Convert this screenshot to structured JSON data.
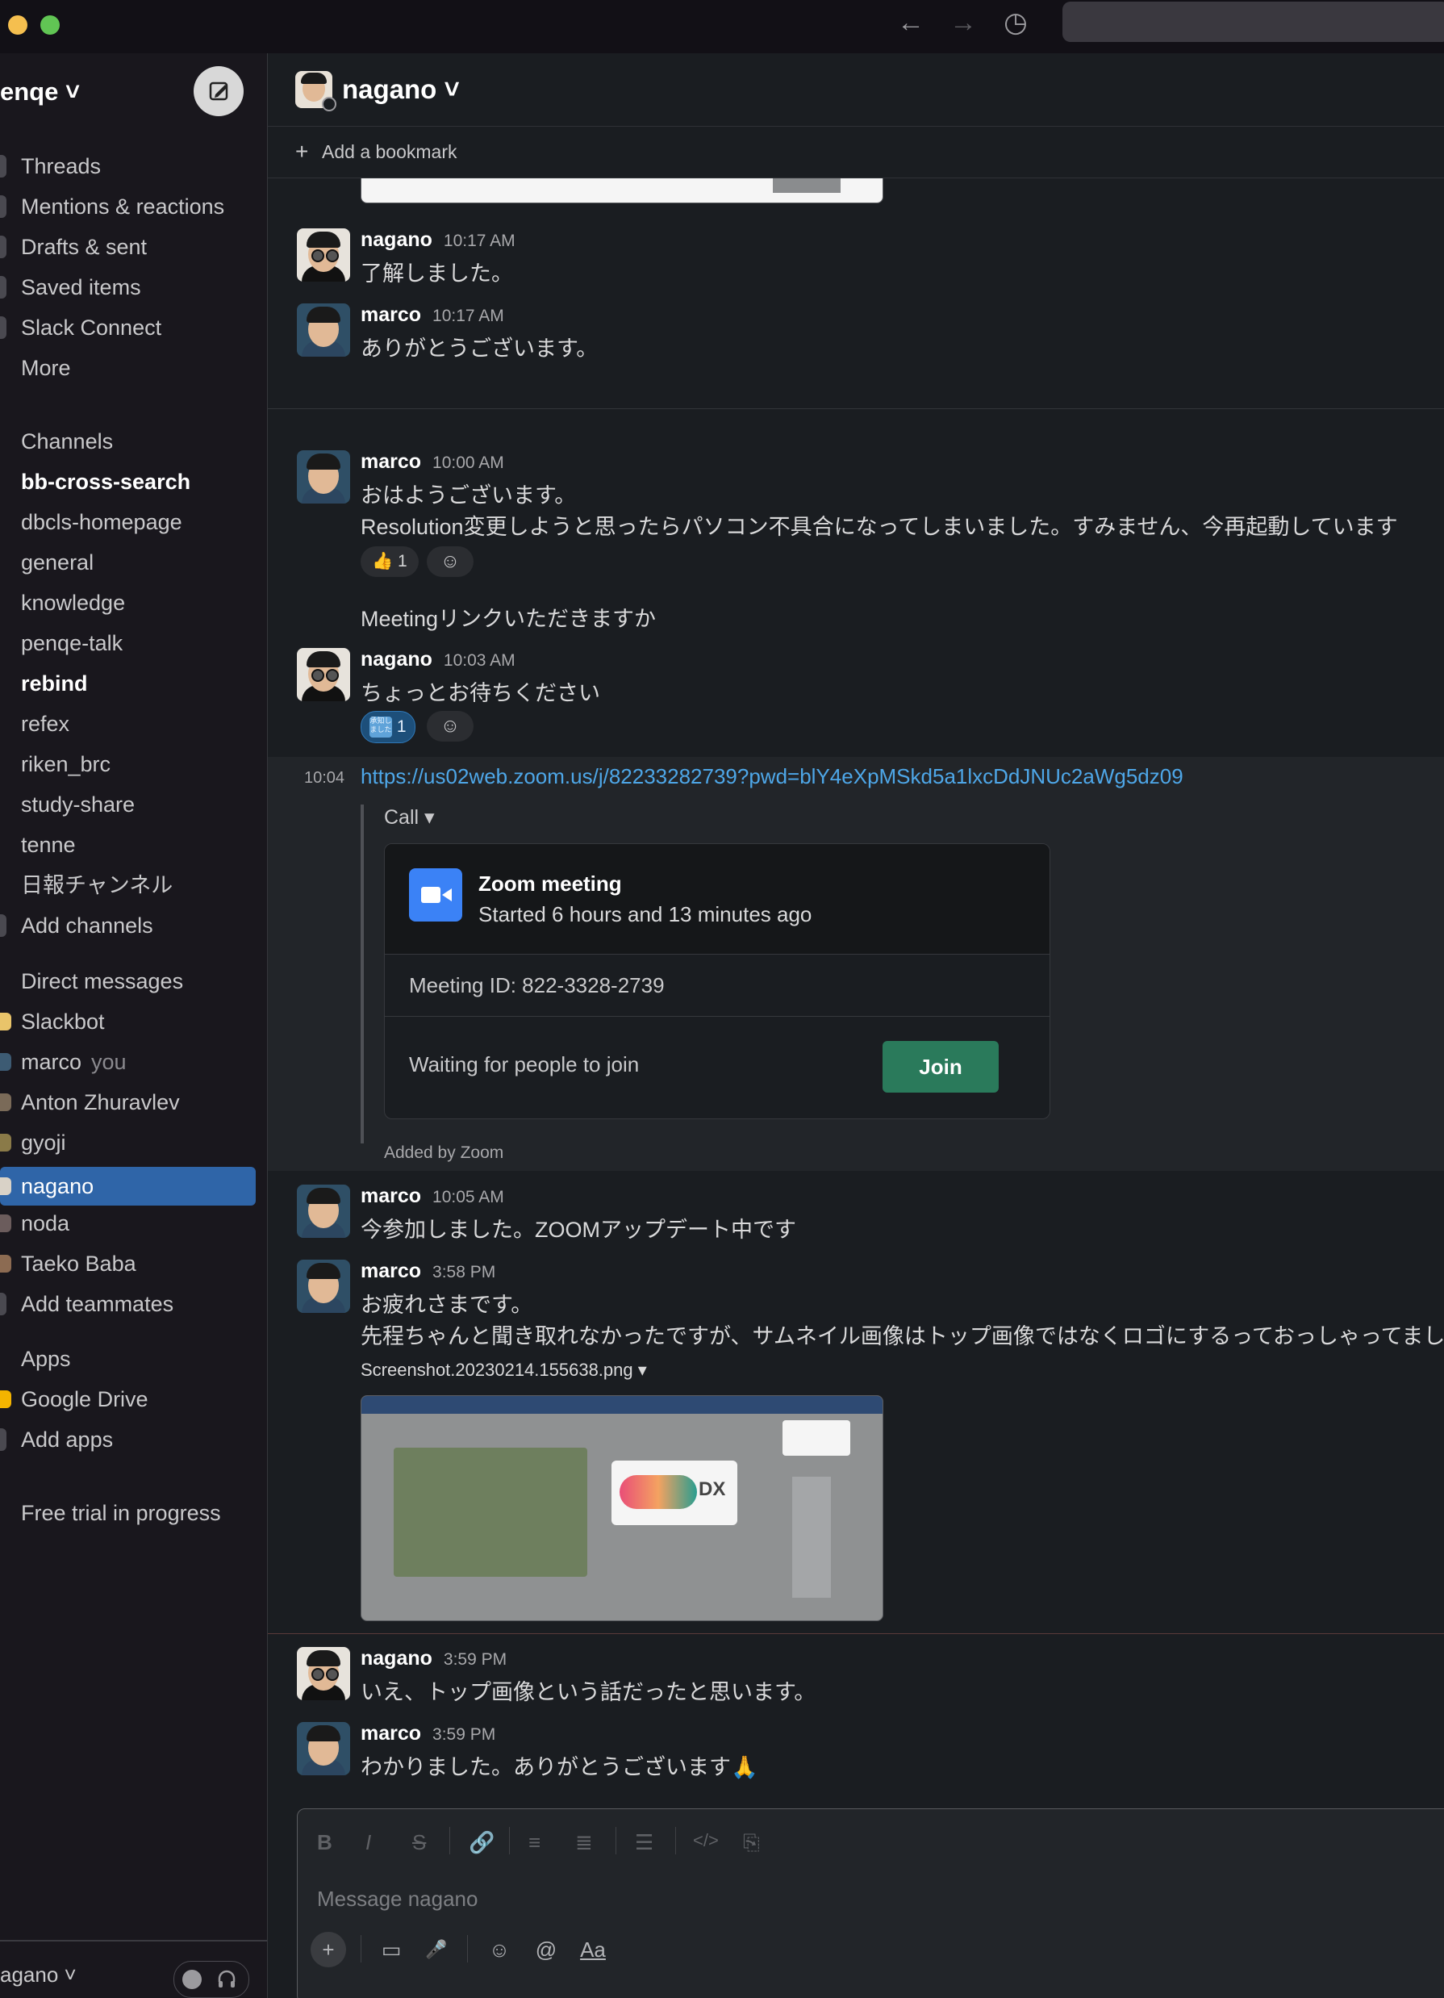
{
  "window": {
    "nav_back": "←",
    "nav_forward": "→",
    "history_icon": "◷"
  },
  "sidebar": {
    "workspace": "enqe ˅",
    "nav": [
      {
        "label": "Threads"
      },
      {
        "label": "Mentions & reactions"
      },
      {
        "label": "Drafts & sent"
      },
      {
        "label": "Saved items"
      },
      {
        "label": "Slack Connect"
      },
      {
        "label": "More"
      }
    ],
    "channels_header": "Channels",
    "channels": [
      {
        "label": "bb-cross-search",
        "bold": true
      },
      {
        "label": "dbcls-homepage"
      },
      {
        "label": "general"
      },
      {
        "label": "knowledge"
      },
      {
        "label": "penqe-talk"
      },
      {
        "label": "rebind",
        "bold": true
      },
      {
        "label": "refex"
      },
      {
        "label": "riken_brc"
      },
      {
        "label": "study-share"
      },
      {
        "label": "tenne"
      },
      {
        "label": "日報チャンネル"
      }
    ],
    "add_channels": "Add channels",
    "dm_header": "Direct messages",
    "dms": [
      {
        "label": "Slackbot"
      },
      {
        "label": "marco",
        "suffix": "you"
      },
      {
        "label": "Anton Zhuravlev"
      },
      {
        "label": "gyoji"
      },
      {
        "label": "nagano",
        "active": true
      },
      {
        "label": "noda"
      },
      {
        "label": "Taeko Baba"
      }
    ],
    "add_teammates": "Add teammates",
    "apps_header": "Apps",
    "apps": [
      {
        "label": "Google Drive"
      }
    ],
    "add_apps": "Add apps",
    "free_trial": "Free trial in progress",
    "footer_user": "agano ˅"
  },
  "channel": {
    "title": "nagano ˅",
    "bookmark": "Add a bookmark"
  },
  "messages": {
    "m1": {
      "sender": "nagano",
      "time": "10:17 AM",
      "text": "了解しました。"
    },
    "m2": {
      "sender": "marco",
      "time": "10:17 AM",
      "text": "ありがとうございます。"
    },
    "m3": {
      "sender": "marco",
      "time": "10:00 AM",
      "line1": "おはようございます。",
      "line2": "Resolution変更しようと思ったらパソコン不具合になってしまいました。すみません、今再起動しています",
      "reaction": "👍 1"
    },
    "m3b": {
      "text": "Meetingリンクいただきますか"
    },
    "m4": {
      "sender": "nagano",
      "time": "10:03 AM",
      "text": "ちょっとお待ちください",
      "reaction_count": "1",
      "reaction_badge": "承知しました"
    },
    "m5": {
      "time": "10:04",
      "link": "https://us02web.zoom.us/j/82233282739?pwd=blY4eXpMSkd5a1lxcDdJNUc2aWg5dz09",
      "call_label": "Call ▾",
      "zoom_title": "Zoom meeting",
      "zoom_sub": "Started 6 hours and 13 minutes ago",
      "meeting_id": "Meeting ID: 822-3328-2739",
      "waiting": "Waiting for people to join",
      "join": "Join",
      "added_by": "Added by Zoom"
    },
    "m6": {
      "sender": "marco",
      "time": "10:05 AM",
      "text": "今参加しました。ZOOMアップデート中です"
    },
    "m7": {
      "sender": "marco",
      "time": "3:58 PM",
      "line1": "お疲れさまです。",
      "line2": "先程ちゃんと聞き取れなかったですが、サムネイル画像はトップ画像ではなくロゴにするっておっしゃってまし",
      "file": "Screenshot.20230214.155638.png ▾"
    },
    "m8": {
      "sender": "nagano",
      "time": "3:59 PM",
      "text": "いえ、トップ画像という話だったと思います。"
    },
    "m9": {
      "sender": "marco",
      "time": "3:59 PM",
      "text": "わかりました。ありがとうございます🙏"
    }
  },
  "composer": {
    "placeholder": "Message nagano",
    "format_icons": [
      "B",
      "I",
      "S",
      "🔗",
      "≡",
      "≣",
      "☰",
      "</>",
      "⎘"
    ],
    "actions": [
      "+",
      "▭",
      "🎤",
      "☺",
      "@",
      "Aa"
    ]
  }
}
